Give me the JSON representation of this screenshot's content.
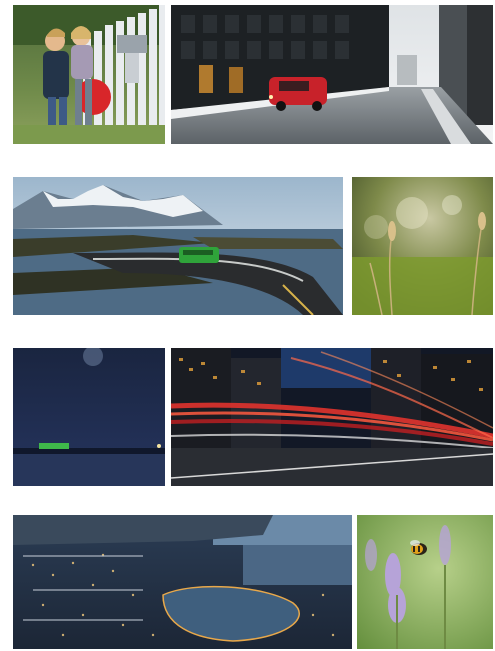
{
  "gallery": {
    "rows": [
      {
        "tiles": [
          {
            "subject": "children-at-mailbox-photo"
          },
          {
            "subject": "red-van-city-street-photo"
          }
        ]
      },
      {
        "tiles": [
          {
            "subject": "coastal-road-bridge-green-bus-photo"
          },
          {
            "subject": "meadow-grass-bokeh-photo"
          }
        ]
      },
      {
        "tiles": [
          {
            "subject": "night-fjord-green-train-photo"
          },
          {
            "subject": "city-night-light-trails-photo"
          }
        ]
      },
      {
        "tiles": [
          {
            "subject": "aerial-city-harbor-dusk-photo"
          },
          {
            "subject": "bee-on-lavender-photo"
          }
        ]
      }
    ]
  }
}
